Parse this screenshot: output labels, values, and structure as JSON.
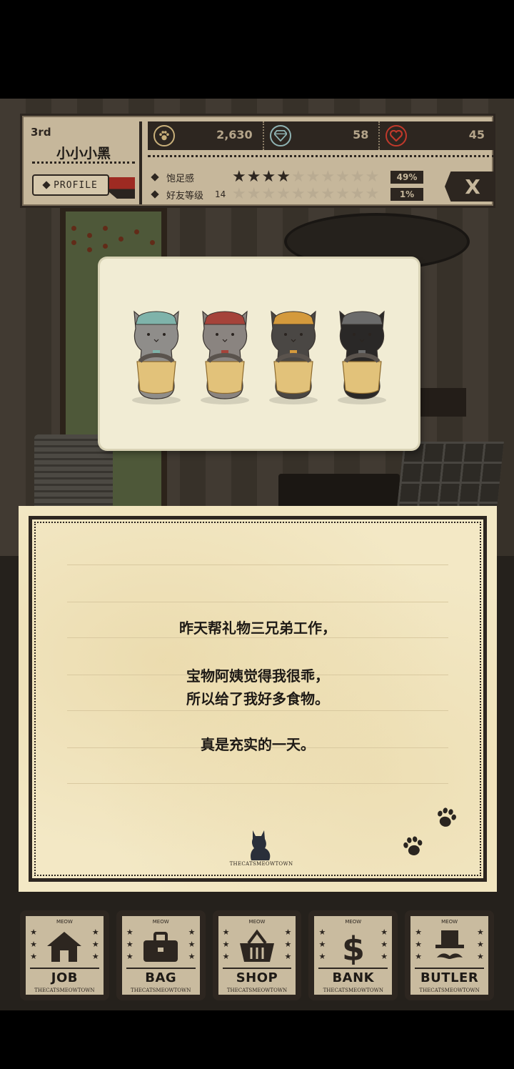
{
  "hud": {
    "rank": "3rd",
    "player_name": "小小小黑",
    "profile_label": "PROFILE",
    "coins": "2,630",
    "gems": "58",
    "hearts": "45",
    "satiety_label": "饱足感",
    "satiety_stars_filled": 4,
    "satiety_stars_total": 10,
    "satiety_percent": "49%",
    "friendship_label": "好友等级",
    "friendship_level": "14",
    "friendship_stars_filled": 0,
    "friendship_stars_total": 10,
    "friendship_percent": "1%",
    "close_label": "X"
  },
  "picture": {
    "cats": [
      {
        "name": "cat-teal",
        "hat_color": "#7fb3aa",
        "body_color": "#8f8d8a"
      },
      {
        "name": "cat-red",
        "hat_color": "#a5433a",
        "body_color": "#8a8480"
      },
      {
        "name": "cat-orange",
        "hat_color": "#d49a3c",
        "body_color": "#4a4744"
      },
      {
        "name": "cat-gray",
        "hat_color": "#6b6b6b",
        "body_color": "#2a2827"
      }
    ]
  },
  "letter": {
    "line1": "昨天帮礼物三兄弟工作，",
    "line2": "宝物阿姨觉得我很乖，",
    "line3": "所以给了我好多食物。",
    "line4": "真是充实的一天。",
    "signature": "THECATSMEOWTOWN"
  },
  "nav": {
    "items": [
      {
        "label": "JOB",
        "top": "MEOW",
        "sub": "THECATSMEOWTOWN",
        "icon": "house-icon"
      },
      {
        "label": "BAG",
        "top": "MEOW",
        "sub": "THECATSMEOWTOWN",
        "icon": "bag-icon"
      },
      {
        "label": "SHOP",
        "top": "MEOW",
        "sub": "THECATSMEOWTOWN",
        "icon": "basket-icon"
      },
      {
        "label": "BANK",
        "top": "MEOW",
        "sub": "THECATSMEOWTOWN",
        "icon": "dollar-icon"
      },
      {
        "label": "BUTLER",
        "top": "MEOW",
        "sub": "THECATSMEOWTOWN",
        "icon": "butler-icon"
      }
    ]
  },
  "colors": {
    "ink": "#2d2620",
    "paper": "#f3e8c5",
    "hud_bg": "#c6b79b",
    "heart": "#c0392b",
    "gem": "#8fb3b3",
    "coin": "#c9b07a"
  }
}
